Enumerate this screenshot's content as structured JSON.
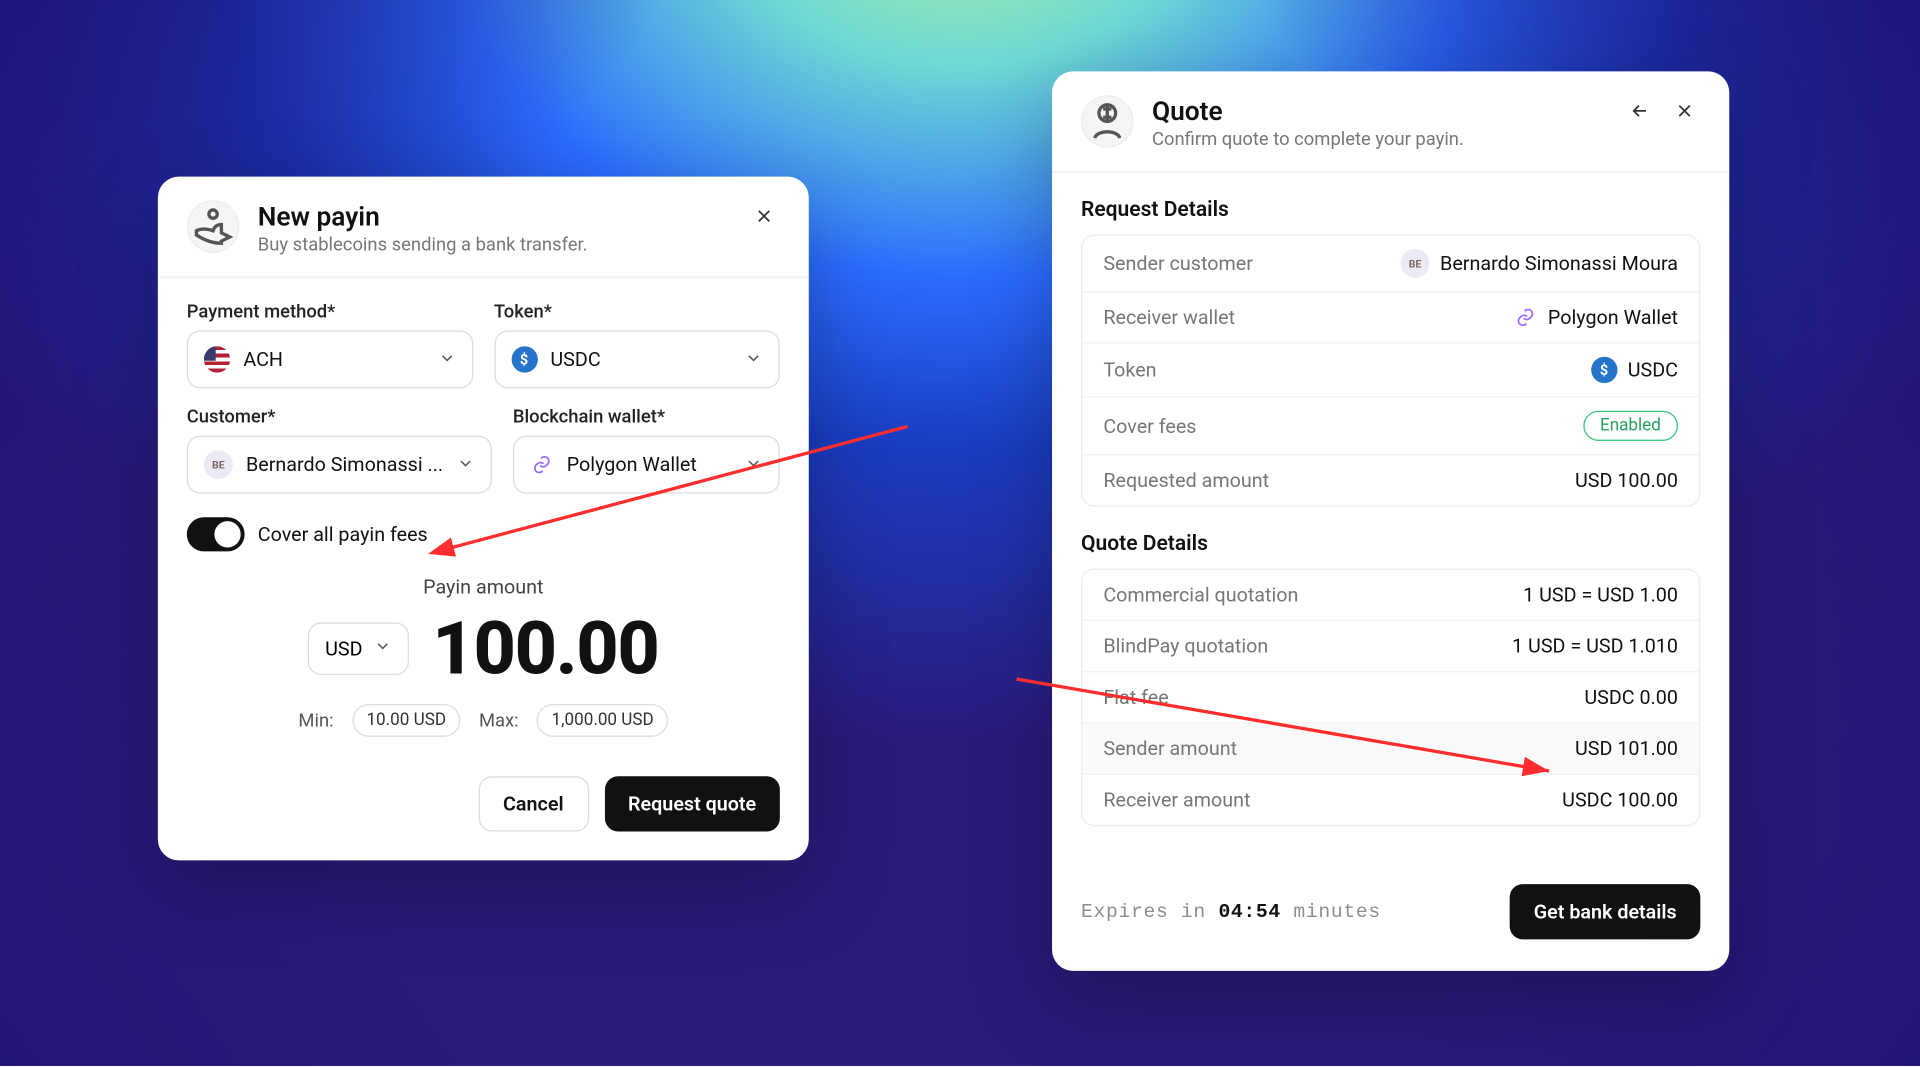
{
  "payin": {
    "title": "New payin",
    "subtitle": "Buy stablecoins sending a bank transfer.",
    "labels": {
      "payment_method": "Payment method*",
      "token": "Token*",
      "customer": "Customer*",
      "blockchain_wallet": "Blockchain wallet*"
    },
    "values": {
      "payment_method": "ACH",
      "token": "USDC",
      "customer": "Bernardo Simonassi ...",
      "customer_initials": "BE",
      "blockchain_wallet": "Polygon Wallet"
    },
    "toggle_label": "Cover all payin fees",
    "amount": {
      "title": "Payin amount",
      "currency": "USD",
      "value": "100.00",
      "min_label": "Min:",
      "min_value": "10.00 USD",
      "max_label": "Max:",
      "max_value": "1,000.00 USD"
    },
    "buttons": {
      "cancel": "Cancel",
      "request": "Request quote"
    }
  },
  "quote": {
    "title": "Quote",
    "subtitle": "Confirm quote to complete your payin.",
    "request_details_title": "Request Details",
    "request_details": {
      "sender_customer_label": "Sender customer",
      "sender_customer_value": "Bernardo Simonassi Moura",
      "sender_initials": "BE",
      "receiver_wallet_label": "Receiver wallet",
      "receiver_wallet_value": "Polygon Wallet",
      "token_label": "Token",
      "token_value": "USDC",
      "cover_fees_label": "Cover fees",
      "cover_fees_value": "Enabled",
      "requested_amount_label": "Requested amount",
      "requested_amount_value": "USD 100.00"
    },
    "quote_details_title": "Quote Details",
    "quote_details": {
      "commercial_label": "Commercial quotation",
      "commercial_value": "1 USD = USD 1.00",
      "blindpay_label": "BlindPay quotation",
      "blindpay_value": "1 USD = USD 1.010",
      "flat_fee_label": "Flat fee",
      "flat_fee_value": "USDC 0.00",
      "sender_amount_label": "Sender amount",
      "sender_amount_value": "USD 101.00",
      "receiver_amount_label": "Receiver amount",
      "receiver_amount_value": "USDC 100.00"
    },
    "expiry": {
      "prefix": "Expires in ",
      "time": "04:54",
      "suffix": " minutes"
    },
    "button": "Get bank details"
  }
}
